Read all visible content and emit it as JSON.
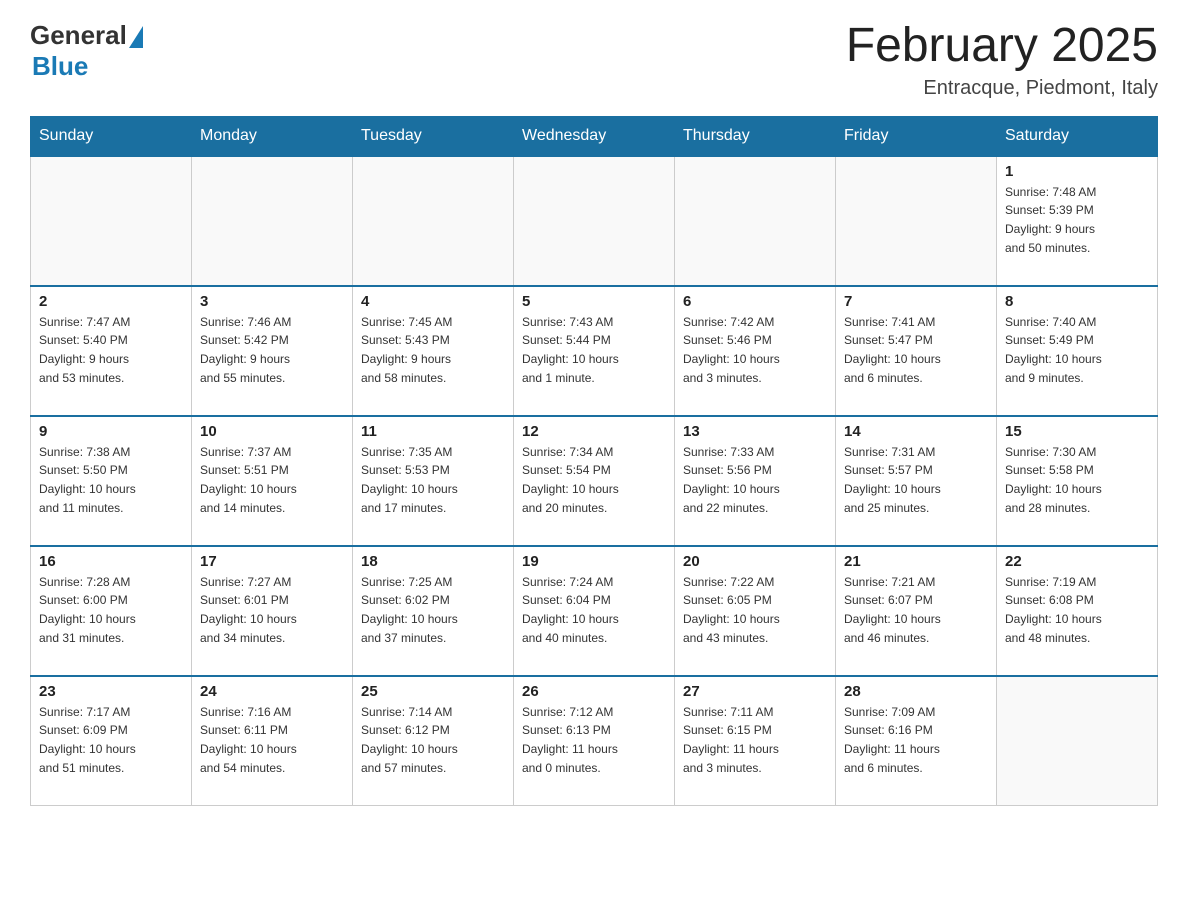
{
  "header": {
    "logo_general": "General",
    "logo_blue": "Blue",
    "month_title": "February 2025",
    "location": "Entracque, Piedmont, Italy"
  },
  "weekdays": [
    "Sunday",
    "Monday",
    "Tuesday",
    "Wednesday",
    "Thursday",
    "Friday",
    "Saturday"
  ],
  "weeks": [
    [
      {
        "day": "",
        "info": "",
        "empty": true
      },
      {
        "day": "",
        "info": "",
        "empty": true
      },
      {
        "day": "",
        "info": "",
        "empty": true
      },
      {
        "day": "",
        "info": "",
        "empty": true
      },
      {
        "day": "",
        "info": "",
        "empty": true
      },
      {
        "day": "",
        "info": "",
        "empty": true
      },
      {
        "day": "1",
        "info": "Sunrise: 7:48 AM\nSunset: 5:39 PM\nDaylight: 9 hours\nand 50 minutes.",
        "empty": false
      }
    ],
    [
      {
        "day": "2",
        "info": "Sunrise: 7:47 AM\nSunset: 5:40 PM\nDaylight: 9 hours\nand 53 minutes.",
        "empty": false
      },
      {
        "day": "3",
        "info": "Sunrise: 7:46 AM\nSunset: 5:42 PM\nDaylight: 9 hours\nand 55 minutes.",
        "empty": false
      },
      {
        "day": "4",
        "info": "Sunrise: 7:45 AM\nSunset: 5:43 PM\nDaylight: 9 hours\nand 58 minutes.",
        "empty": false
      },
      {
        "day": "5",
        "info": "Sunrise: 7:43 AM\nSunset: 5:44 PM\nDaylight: 10 hours\nand 1 minute.",
        "empty": false
      },
      {
        "day": "6",
        "info": "Sunrise: 7:42 AM\nSunset: 5:46 PM\nDaylight: 10 hours\nand 3 minutes.",
        "empty": false
      },
      {
        "day": "7",
        "info": "Sunrise: 7:41 AM\nSunset: 5:47 PM\nDaylight: 10 hours\nand 6 minutes.",
        "empty": false
      },
      {
        "day": "8",
        "info": "Sunrise: 7:40 AM\nSunset: 5:49 PM\nDaylight: 10 hours\nand 9 minutes.",
        "empty": false
      }
    ],
    [
      {
        "day": "9",
        "info": "Sunrise: 7:38 AM\nSunset: 5:50 PM\nDaylight: 10 hours\nand 11 minutes.",
        "empty": false
      },
      {
        "day": "10",
        "info": "Sunrise: 7:37 AM\nSunset: 5:51 PM\nDaylight: 10 hours\nand 14 minutes.",
        "empty": false
      },
      {
        "day": "11",
        "info": "Sunrise: 7:35 AM\nSunset: 5:53 PM\nDaylight: 10 hours\nand 17 minutes.",
        "empty": false
      },
      {
        "day": "12",
        "info": "Sunrise: 7:34 AM\nSunset: 5:54 PM\nDaylight: 10 hours\nand 20 minutes.",
        "empty": false
      },
      {
        "day": "13",
        "info": "Sunrise: 7:33 AM\nSunset: 5:56 PM\nDaylight: 10 hours\nand 22 minutes.",
        "empty": false
      },
      {
        "day": "14",
        "info": "Sunrise: 7:31 AM\nSunset: 5:57 PM\nDaylight: 10 hours\nand 25 minutes.",
        "empty": false
      },
      {
        "day": "15",
        "info": "Sunrise: 7:30 AM\nSunset: 5:58 PM\nDaylight: 10 hours\nand 28 minutes.",
        "empty": false
      }
    ],
    [
      {
        "day": "16",
        "info": "Sunrise: 7:28 AM\nSunset: 6:00 PM\nDaylight: 10 hours\nand 31 minutes.",
        "empty": false
      },
      {
        "day": "17",
        "info": "Sunrise: 7:27 AM\nSunset: 6:01 PM\nDaylight: 10 hours\nand 34 minutes.",
        "empty": false
      },
      {
        "day": "18",
        "info": "Sunrise: 7:25 AM\nSunset: 6:02 PM\nDaylight: 10 hours\nand 37 minutes.",
        "empty": false
      },
      {
        "day": "19",
        "info": "Sunrise: 7:24 AM\nSunset: 6:04 PM\nDaylight: 10 hours\nand 40 minutes.",
        "empty": false
      },
      {
        "day": "20",
        "info": "Sunrise: 7:22 AM\nSunset: 6:05 PM\nDaylight: 10 hours\nand 43 minutes.",
        "empty": false
      },
      {
        "day": "21",
        "info": "Sunrise: 7:21 AM\nSunset: 6:07 PM\nDaylight: 10 hours\nand 46 minutes.",
        "empty": false
      },
      {
        "day": "22",
        "info": "Sunrise: 7:19 AM\nSunset: 6:08 PM\nDaylight: 10 hours\nand 48 minutes.",
        "empty": false
      }
    ],
    [
      {
        "day": "23",
        "info": "Sunrise: 7:17 AM\nSunset: 6:09 PM\nDaylight: 10 hours\nand 51 minutes.",
        "empty": false
      },
      {
        "day": "24",
        "info": "Sunrise: 7:16 AM\nSunset: 6:11 PM\nDaylight: 10 hours\nand 54 minutes.",
        "empty": false
      },
      {
        "day": "25",
        "info": "Sunrise: 7:14 AM\nSunset: 6:12 PM\nDaylight: 10 hours\nand 57 minutes.",
        "empty": false
      },
      {
        "day": "26",
        "info": "Sunrise: 7:12 AM\nSunset: 6:13 PM\nDaylight: 11 hours\nand 0 minutes.",
        "empty": false
      },
      {
        "day": "27",
        "info": "Sunrise: 7:11 AM\nSunset: 6:15 PM\nDaylight: 11 hours\nand 3 minutes.",
        "empty": false
      },
      {
        "day": "28",
        "info": "Sunrise: 7:09 AM\nSunset: 6:16 PM\nDaylight: 11 hours\nand 6 minutes.",
        "empty": false
      },
      {
        "day": "",
        "info": "",
        "empty": true
      }
    ]
  ]
}
